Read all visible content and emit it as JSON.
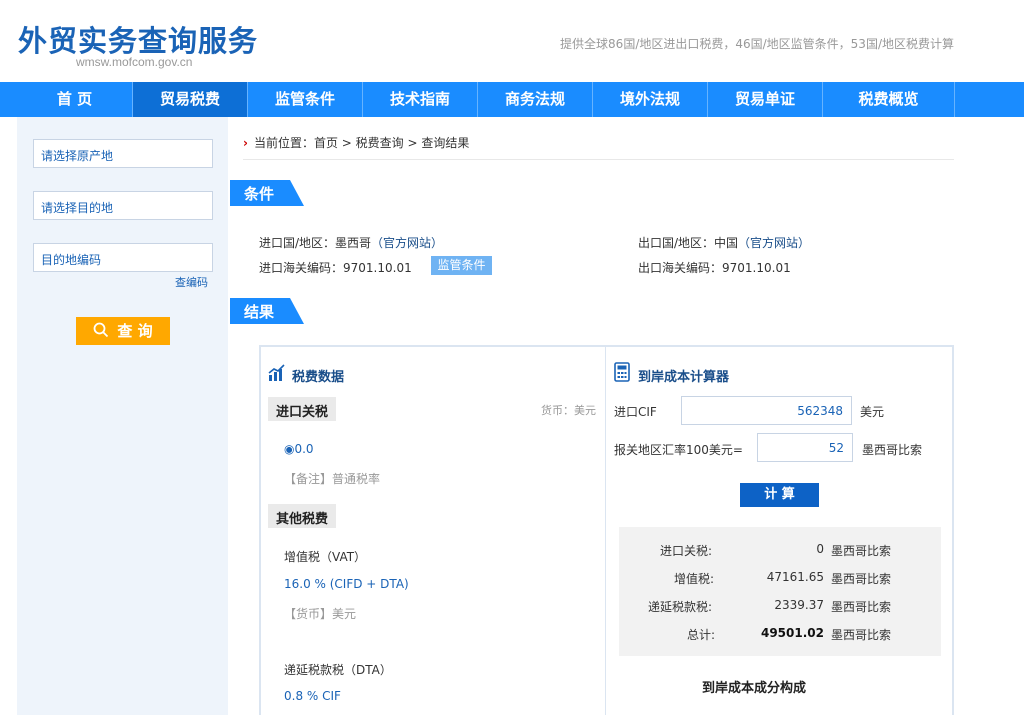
{
  "header": {
    "title": "外贸实务查询服务",
    "domain": "wmsw.mofcom.gov.cn",
    "tagline": "提供全球86国/地区进出口税费，46国/地区监管条件，53国/地区税费计算"
  },
  "nav": {
    "items": [
      "首 页",
      "贸易税费",
      "监管条件",
      "技术指南",
      "商务法规",
      "境外法规",
      "贸易单证",
      "税费概览"
    ],
    "active_index": 1
  },
  "sidebar": {
    "origin_placeholder": "请选择原产地",
    "dest_placeholder": "请选择目的地",
    "code_placeholder": "目的地编码",
    "lookup_link": "查编码",
    "search_label": "查 询"
  },
  "breadcrumb": {
    "text": "当前位置：首页 > 税费查询 > 查询结果"
  },
  "conditions": {
    "section_title": "条件",
    "import_country_label": "进口国/地区：墨西哥",
    "import_official": "（官方网站）",
    "import_code": "进口海关编码：9701.10.01",
    "supervision_badge": "监管条件",
    "export_country_label": "出口国/地区：中国",
    "export_official": "（官方网站）",
    "export_code": "出口海关编码：9701.10.01"
  },
  "results": {
    "section_title": "结果",
    "tax_title": "税费数据",
    "import_duty_tag": "进口关税",
    "currency_note": "货币：美元",
    "rate_value": "0.0",
    "rate_remark": "【备注】普通税率",
    "other_tag": "其他税费",
    "vat_label": "增值税（VAT）",
    "vat_value": "16.0 % (CIFD + DTA)",
    "vat_currency": "【货币】美元",
    "dta_label": "递延税款税（DTA）",
    "dta_value": "0.8 % CIF"
  },
  "calculator": {
    "title": "到岸成本计算器",
    "cif_label": "进口CIF",
    "cif_value": "562348",
    "cif_unit": "美元",
    "rate_label": "报关地区汇率100美元=",
    "rate_value": "52",
    "rate_unit": "墨西哥比索",
    "calc_button": "计 算",
    "rows": [
      {
        "label": "进口关税:",
        "value": "0",
        "unit": "墨西哥比索"
      },
      {
        "label": "增值税:",
        "value": "47161.65",
        "unit": "墨西哥比索"
      },
      {
        "label": "递延税款税:",
        "value": "2339.37",
        "unit": "墨西哥比索"
      },
      {
        "label": "总计:",
        "value": "49501.02",
        "unit": "墨西哥比索"
      }
    ],
    "composition_title": "到岸成本成分构成"
  },
  "colors": {
    "brand_blue": "#1a8cff",
    "dark_blue": "#1a63b6",
    "search_orange": "#ffa800"
  }
}
